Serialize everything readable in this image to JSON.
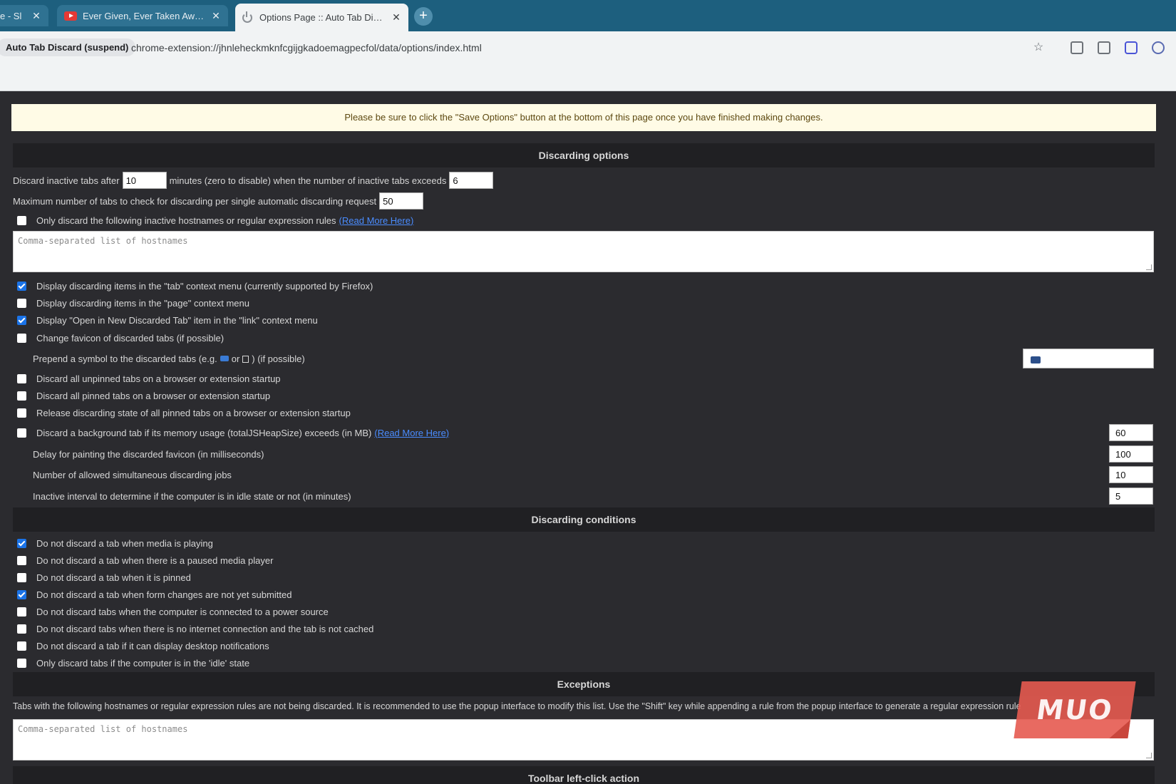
{
  "browser": {
    "tabs": [
      {
        "title": "e - Sl",
        "active": false
      },
      {
        "title": "Ever Given, Ever Taken Away - Y",
        "active": false
      },
      {
        "title": "Options Page :: Auto Tab Discard",
        "active": true
      }
    ],
    "new_tab_label": "+",
    "close_glyph": "✕",
    "extension_chip": "Auto Tab Discard (suspend)",
    "url": "chrome-extension://jhnleheckmknfcgijgkadoemagpecfol/data/options/index.html",
    "icons": [
      "star-icon",
      "screenshot-icon",
      "reader-mode-icon",
      "extension-icon",
      "profile-icon"
    ]
  },
  "notice": "Please be sure to click the \"Save Options\" button at the bottom of this page once you have finished making changes.",
  "discarding_options": {
    "heading": "Discarding options",
    "discard_after_prefix": "Discard inactive tabs after",
    "discard_after_value": "10",
    "discard_after_middle": "minutes (zero to disable) when the number of inactive tabs exceeds",
    "inactive_count_value": "6",
    "max_tabs_label": "Maximum number of tabs to check for discarding per single automatic discarding request",
    "max_tabs_value": "50",
    "only_discard_label": "Only discard the following inactive hostnames or regular expression rules",
    "read_more": "(Read More Here)",
    "hostnames_placeholder": "Comma-separated list of hostnames",
    "checkboxes": [
      {
        "label": "Display discarding items in the \"tab\" context menu (currently supported by Firefox)",
        "checked": true
      },
      {
        "label": "Display discarding items in the \"page\" context menu",
        "checked": false
      },
      {
        "label": "Display \"Open in New Discarded Tab\" item in the \"link\" context menu",
        "checked": true
      },
      {
        "label": "Change favicon of discarded tabs (if possible)",
        "checked": false
      }
    ],
    "prepend_prefix": "Prepend a symbol to the discarded tabs (e.g.",
    "prepend_or": "or",
    "prepend_suffix": ") (if possible)",
    "startup_checkboxes": [
      {
        "label": "Discard all unpinned tabs on a browser or extension startup",
        "checked": false
      },
      {
        "label": "Discard all pinned tabs on a browser or extension startup",
        "checked": false
      },
      {
        "label": "Release discarding state of all pinned tabs on a browser or extension startup",
        "checked": false
      }
    ],
    "memory_label": "Discard a background tab if its memory usage (totalJSHeapSize) exceeds (in MB)",
    "memory_checked": false,
    "memory_value": "60",
    "favicon_delay_label": "Delay for painting the discarded favicon (in milliseconds)",
    "favicon_delay_value": "100",
    "simultaneous_label": "Number of allowed simultaneous discarding jobs",
    "simultaneous_value": "10",
    "idle_interval_label": "Inactive interval to determine if the computer is in idle state or not (in minutes)",
    "idle_interval_value": "5"
  },
  "discarding_conditions": {
    "heading": "Discarding conditions",
    "items": [
      {
        "label": "Do not discard a tab when media is playing",
        "checked": true
      },
      {
        "label": "Do not discard a tab when there is a paused media player",
        "checked": false
      },
      {
        "label": "Do not discard a tab when it is pinned",
        "checked": false
      },
      {
        "label": "Do not discard a tab when form changes are not yet submitted",
        "checked": true
      },
      {
        "label": "Do not discard tabs when the computer is connected to a power source",
        "checked": false
      },
      {
        "label": "Do not discard tabs when there is no internet connection and the tab is not cached",
        "checked": false
      },
      {
        "label": "Do not discard a tab if it can display desktop notifications",
        "checked": false
      },
      {
        "label": "Only discard tabs if the computer is in the 'idle' state",
        "checked": false
      }
    ]
  },
  "exceptions": {
    "heading": "Exceptions",
    "description": "Tabs with the following hostnames or regular expression rules are not being discarded. It is recommended to use the popup interface to modify this list. Use the \"Shift\" key while appending a rule from the popup interface to generate a regular expression rule",
    "placeholder": "Comma-separated list of hostnames"
  },
  "toolbar": {
    "heading": "Toolbar left-click action"
  },
  "watermark": "MUO",
  "colors": {
    "tabstrip": "#1d5f7e",
    "page_bg": "#2b2b2f",
    "section_head": "#202023",
    "notice_bg": "#fffbe6",
    "link": "#4a8cff",
    "checkbox_checked": "#1a73e8"
  }
}
